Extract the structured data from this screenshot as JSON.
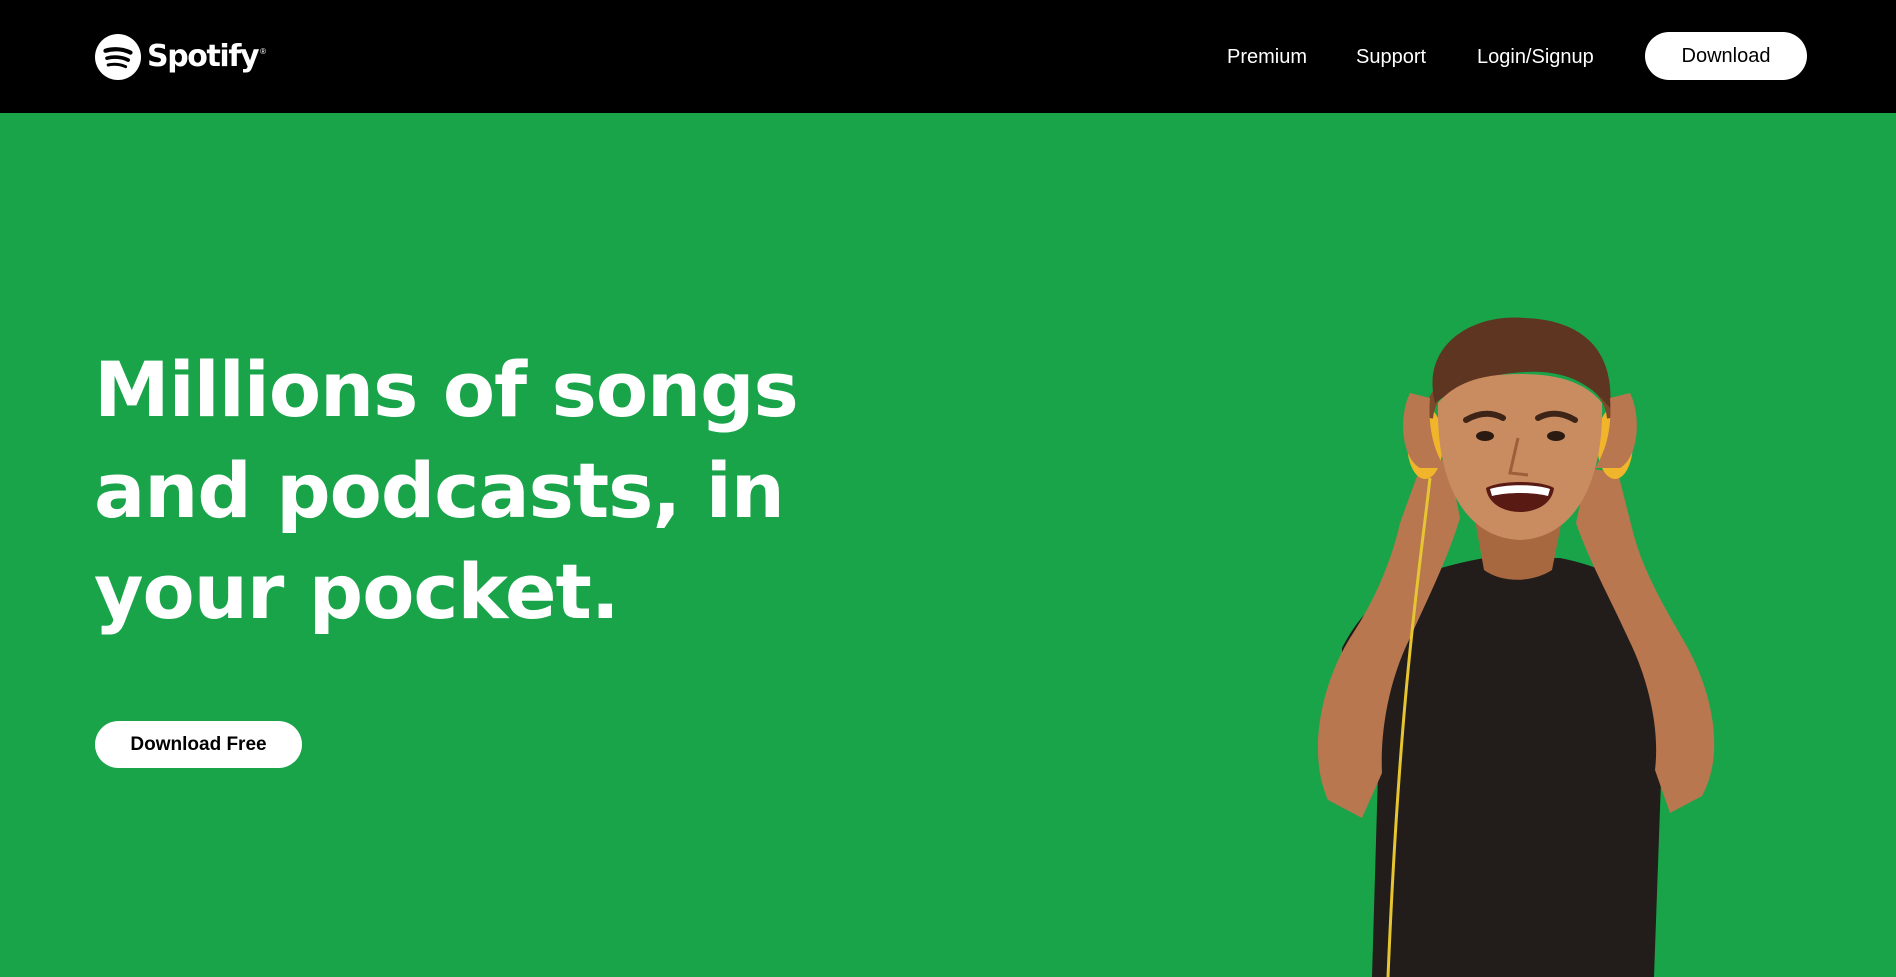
{
  "brand": {
    "name": "Spotify",
    "registered_mark": "®",
    "icon": "spotify-logo-icon"
  },
  "nav": {
    "links": [
      {
        "label": "Premium"
      },
      {
        "label": "Support"
      },
      {
        "label": "Login/Signup"
      }
    ],
    "download_label": "Download"
  },
  "hero": {
    "title": "Millions of songs and podcasts, in your pocket.",
    "cta_label": "Download Free",
    "image": "man-with-headphones-photo"
  },
  "colors": {
    "navbar": "#000000",
    "hero_background": "#19a44a",
    "button_background": "#ffffff",
    "text_light": "#ffffff",
    "text_dark": "#000000"
  }
}
